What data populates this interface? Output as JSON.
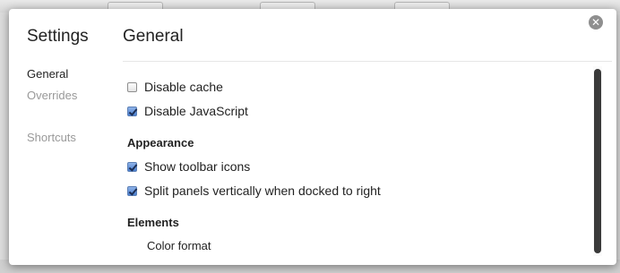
{
  "sidebar": {
    "title": "Settings",
    "items": [
      {
        "label": "General",
        "selected": true
      },
      {
        "label": "Overrides",
        "selected": false
      },
      {
        "label": "Shortcuts",
        "selected": false
      }
    ]
  },
  "main": {
    "title": "General",
    "options": [
      {
        "label": "Disable cache",
        "checked": false
      },
      {
        "label": "Disable JavaScript",
        "checked": true
      }
    ],
    "sections": [
      {
        "heading": "Appearance",
        "options": [
          {
            "label": "Show toolbar icons",
            "checked": true
          },
          {
            "label": "Split panels vertically when docked to right",
            "checked": true
          }
        ]
      },
      {
        "heading": "Elements",
        "items": [
          {
            "label": "Color format"
          }
        ]
      }
    ]
  },
  "close": {
    "glyph": "✕",
    "icon": "close-icon"
  },
  "colors": {
    "checkbox_checked": "#4a7fd0",
    "scrollbar_thumb": "#3a3a3a"
  }
}
